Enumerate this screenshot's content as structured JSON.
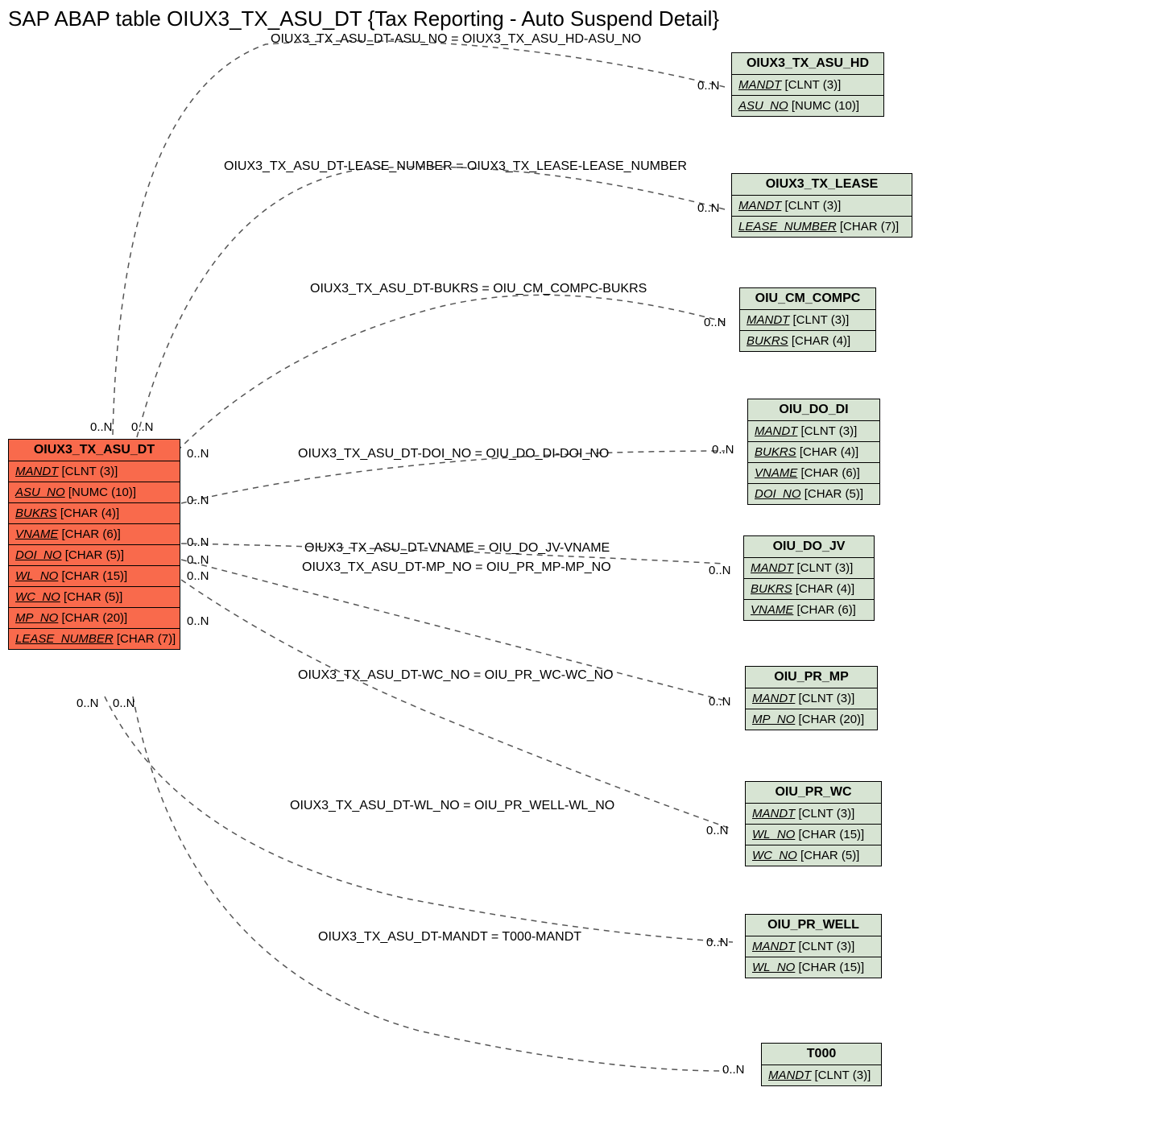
{
  "title": "SAP ABAP table OIUX3_TX_ASU_DT {Tax Reporting - Auto Suspend Detail}",
  "main": {
    "name": "OIUX3_TX_ASU_DT",
    "fields": [
      {
        "f": "MANDT",
        "t": "[CLNT (3)]"
      },
      {
        "f": "ASU_NO",
        "t": "[NUMC (10)]"
      },
      {
        "f": "BUKRS",
        "t": "[CHAR (4)]"
      },
      {
        "f": "VNAME",
        "t": "[CHAR (6)]"
      },
      {
        "f": "DOI_NO",
        "t": "[CHAR (5)]"
      },
      {
        "f": "WL_NO",
        "t": "[CHAR (15)]"
      },
      {
        "f": "WC_NO",
        "t": "[CHAR (5)]"
      },
      {
        "f": "MP_NO",
        "t": "[CHAR (20)]"
      },
      {
        "f": "LEASE_NUMBER",
        "t": "[CHAR (7)]"
      }
    ]
  },
  "related": [
    {
      "name": "OIUX3_TX_ASU_HD",
      "fields": [
        {
          "f": "MANDT",
          "t": "[CLNT (3)]"
        },
        {
          "f": "ASU_NO",
          "t": "[NUMC (10)]"
        }
      ]
    },
    {
      "name": "OIUX3_TX_LEASE",
      "fields": [
        {
          "f": "MANDT",
          "t": "[CLNT (3)]"
        },
        {
          "f": "LEASE_NUMBER",
          "t": "[CHAR (7)]"
        }
      ]
    },
    {
      "name": "OIU_CM_COMPC",
      "fields": [
        {
          "f": "MANDT",
          "t": "[CLNT (3)]"
        },
        {
          "f": "BUKRS",
          "t": "[CHAR (4)]"
        }
      ]
    },
    {
      "name": "OIU_DO_DI",
      "fields": [
        {
          "f": "MANDT",
          "t": "[CLNT (3)]"
        },
        {
          "f": "BUKRS",
          "t": "[CHAR (4)]"
        },
        {
          "f": "VNAME",
          "t": "[CHAR (6)]"
        },
        {
          "f": "DOI_NO",
          "t": "[CHAR (5)]"
        }
      ]
    },
    {
      "name": "OIU_DO_JV",
      "fields": [
        {
          "f": "MANDT",
          "t": "[CLNT (3)]"
        },
        {
          "f": "BUKRS",
          "t": "[CHAR (4)]"
        },
        {
          "f": "VNAME",
          "t": "[CHAR (6)]"
        }
      ]
    },
    {
      "name": "OIU_PR_MP",
      "fields": [
        {
          "f": "MANDT",
          "t": "[CLNT (3)]"
        },
        {
          "f": "MP_NO",
          "t": "[CHAR (20)]"
        }
      ]
    },
    {
      "name": "OIU_PR_WC",
      "fields": [
        {
          "f": "MANDT",
          "t": "[CLNT (3)]"
        },
        {
          "f": "WL_NO",
          "t": "[CHAR (15)]"
        },
        {
          "f": "WC_NO",
          "t": "[CHAR (5)]"
        }
      ]
    },
    {
      "name": "OIU_PR_WELL",
      "fields": [
        {
          "f": "MANDT",
          "t": "[CLNT (3)]"
        },
        {
          "f": "WL_NO",
          "t": "[CHAR (15)]"
        }
      ]
    },
    {
      "name": "T000",
      "fields": [
        {
          "f": "MANDT",
          "t": "[CLNT (3)]"
        }
      ]
    }
  ],
  "rel_labels": [
    "OIUX3_TX_ASU_DT-ASU_NO = OIUX3_TX_ASU_HD-ASU_NO",
    "OIUX3_TX_ASU_DT-LEASE_NUMBER = OIUX3_TX_LEASE-LEASE_NUMBER",
    "OIUX3_TX_ASU_DT-BUKRS = OIU_CM_COMPC-BUKRS",
    "OIUX3_TX_ASU_DT-DOI_NO = OIU_DO_DI-DOI_NO",
    "OIUX3_TX_ASU_DT-VNAME = OIU_DO_JV-VNAME",
    "OIUX3_TX_ASU_DT-MP_NO = OIU_PR_MP-MP_NO",
    "OIUX3_TX_ASU_DT-WC_NO = OIU_PR_WC-WC_NO",
    "OIUX3_TX_ASU_DT-WL_NO = OIU_PR_WELL-WL_NO",
    "OIUX3_TX_ASU_DT-MANDT = T000-MANDT"
  ],
  "card": "0..N"
}
